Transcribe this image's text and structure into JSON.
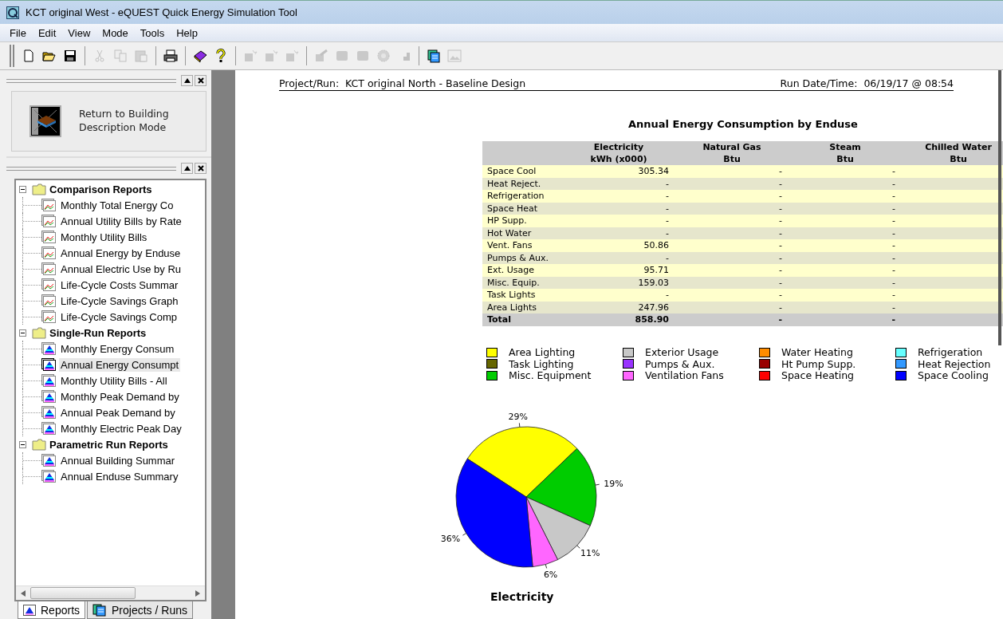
{
  "window": {
    "title": "KCT original West - eQUEST Quick Energy Simulation Tool"
  },
  "menu": [
    "File",
    "Edit",
    "View",
    "Mode",
    "Tools",
    "Help"
  ],
  "toolbar": [
    {
      "kind": "new",
      "disabled": false
    },
    {
      "kind": "open",
      "disabled": false
    },
    {
      "kind": "save",
      "disabled": false
    },
    {
      "kind": "sep"
    },
    {
      "kind": "cut",
      "disabled": true
    },
    {
      "kind": "copy",
      "disabled": true
    },
    {
      "kind": "paste",
      "disabled": true
    },
    {
      "kind": "sep"
    },
    {
      "kind": "print",
      "disabled": false
    },
    {
      "kind": "sep"
    },
    {
      "kind": "book",
      "disabled": false
    },
    {
      "kind": "help",
      "disabled": false
    },
    {
      "kind": "sep"
    },
    {
      "kind": "wand",
      "disabled": true
    },
    {
      "kind": "wand",
      "disabled": true
    },
    {
      "kind": "wand",
      "disabled": true
    },
    {
      "kind": "sep"
    },
    {
      "kind": "tool",
      "disabled": true
    },
    {
      "kind": "block",
      "disabled": true
    },
    {
      "kind": "block",
      "disabled": true
    },
    {
      "kind": "gear",
      "disabled": true
    },
    {
      "kind": "steps",
      "disabled": true
    },
    {
      "kind": "sep"
    },
    {
      "kind": "stack",
      "disabled": false
    },
    {
      "kind": "image",
      "disabled": true
    }
  ],
  "mode_button": {
    "label": "Return to Building Description Mode"
  },
  "tree": [
    {
      "label": "Comparison Reports",
      "expanded": true,
      "children": [
        {
          "label": "Monthly Total Energy Co",
          "kind": "comparison",
          "selected": false
        },
        {
          "label": "Annual Utility Bills by Rate",
          "kind": "comparison",
          "selected": false
        },
        {
          "label": "Monthly Utility Bills",
          "kind": "comparison",
          "selected": false
        },
        {
          "label": "Annual Energy by Enduse",
          "kind": "comparison",
          "selected": false
        },
        {
          "label": "Annual Electric Use by Ru",
          "kind": "comparison",
          "selected": false
        },
        {
          "label": "Life-Cycle Costs Summar",
          "kind": "comparison",
          "selected": false
        },
        {
          "label": "Life-Cycle Savings Graph",
          "kind": "comparison",
          "selected": false
        },
        {
          "label": "Life-Cycle Savings Comp",
          "kind": "comparison",
          "selected": false
        }
      ]
    },
    {
      "label": "Single-Run Reports",
      "expanded": true,
      "children": [
        {
          "label": "Monthly Energy Consum",
          "kind": "single",
          "selected": false
        },
        {
          "label": "Annual Energy Consumpt",
          "kind": "single",
          "selected": true
        },
        {
          "label": "Monthly Utility Bills - All",
          "kind": "single",
          "selected": false
        },
        {
          "label": "Monthly Peak Demand by",
          "kind": "single",
          "selected": false
        },
        {
          "label": "Annual Peak Demand by",
          "kind": "single",
          "selected": false
        },
        {
          "label": "Monthly Electric Peak Day",
          "kind": "single",
          "selected": false
        }
      ]
    },
    {
      "label": "Parametric Run Reports",
      "expanded": true,
      "children": [
        {
          "label": "Annual Building Summar",
          "kind": "single",
          "selected": false
        },
        {
          "label": "Annual Enduse Summary",
          "kind": "single",
          "selected": false
        }
      ]
    }
  ],
  "bottom_tabs": [
    {
      "label": "Reports",
      "kind": "reports",
      "selected": true
    },
    {
      "label": "Projects / Runs",
      "kind": "projects",
      "selected": false
    }
  ],
  "report": {
    "project_label": "Project/Run:",
    "project": "KCT original North - Baseline Design",
    "date_label": "Run Date/Time:",
    "date": "06/19/17 @ 08:54",
    "title": "Annual Energy Consumption by Enduse",
    "table": {
      "columns": [
        {
          "name": "Electricity",
          "unit": "kWh (x000)"
        },
        {
          "name": "Natural Gas",
          "unit": "Btu"
        },
        {
          "name": "Steam",
          "unit": "Btu"
        },
        {
          "name": "Chilled Water",
          "unit": "Btu"
        }
      ],
      "rows": [
        {
          "label": "Space Cool",
          "values": [
            "305.34",
            "-",
            "-"
          ]
        },
        {
          "label": "Heat Reject.",
          "values": [
            "-",
            "-",
            "-"
          ]
        },
        {
          "label": "Refrigeration",
          "values": [
            "-",
            "-",
            "-"
          ]
        },
        {
          "label": "Space Heat",
          "values": [
            "-",
            "-",
            "-"
          ]
        },
        {
          "label": "HP Supp.",
          "values": [
            "-",
            "-",
            "-"
          ]
        },
        {
          "label": "Hot Water",
          "values": [
            "-",
            "-",
            "-"
          ]
        },
        {
          "label": "Vent. Fans",
          "values": [
            "50.86",
            "-",
            "-"
          ]
        },
        {
          "label": "Pumps & Aux.",
          "values": [
            "-",
            "-",
            "-"
          ]
        },
        {
          "label": "Ext. Usage",
          "values": [
            "95.71",
            "-",
            "-"
          ]
        },
        {
          "label": "Misc. Equip.",
          "values": [
            "159.03",
            "-",
            "-"
          ]
        },
        {
          "label": "Task Lights",
          "values": [
            "-",
            "-",
            "-"
          ]
        },
        {
          "label": "Area Lights",
          "values": [
            "247.96",
            "-",
            "-"
          ]
        }
      ],
      "total": {
        "label": "Total",
        "values": [
          "858.90",
          "-",
          "-"
        ]
      }
    },
    "chart_data": {
      "type": "pie",
      "categories": [
        "Area Lighting",
        "Task Lighting",
        "Misc. Equipment",
        "Exterior Usage",
        "Pumps & Aux.",
        "Ventilation Fans",
        "Water Heating",
        "Ht Pump Supp.",
        "Space Heating",
        "Refrigeration",
        "Heat Rejection",
        "Space Cooling"
      ],
      "series": [
        {
          "name": "Electricity",
          "values": [
            29,
            0,
            19,
            11,
            0,
            6,
            0,
            0,
            0,
            0,
            0,
            36
          ]
        }
      ],
      "colors": [
        "#ffff00",
        "#666600",
        "#00cc00",
        "#c8c8c8",
        "#9933ff",
        "#ff66ff",
        "#ff8c00",
        "#990000",
        "#ff0000",
        "#66ffff",
        "#3399ff",
        "#0000ff"
      ],
      "legend": "top",
      "value_labels": [
        "29%",
        null,
        "19%",
        "11%",
        null,
        "6%",
        null,
        null,
        null,
        null,
        null,
        "36%"
      ]
    }
  }
}
